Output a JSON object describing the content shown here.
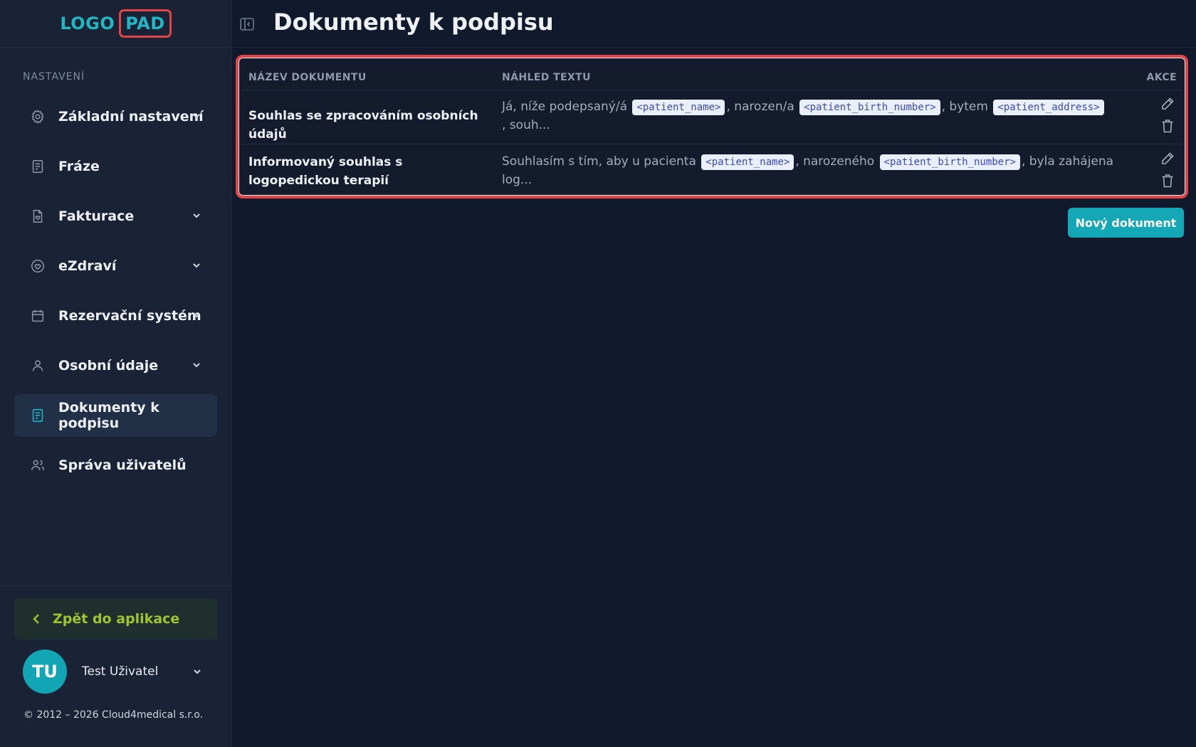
{
  "logo": {
    "left": "LOGO",
    "right": "PAD"
  },
  "sidebar": {
    "section_label": "NASTAVENÍ",
    "items": [
      {
        "label": "Základní nastavení",
        "icon": "gear-icon",
        "has_chevron": true,
        "active": false
      },
      {
        "label": "Fráze",
        "icon": "document-icon",
        "has_chevron": false,
        "active": false
      },
      {
        "label": "Fakturace",
        "icon": "invoice-icon",
        "has_chevron": true,
        "active": false
      },
      {
        "label": "eZdraví",
        "icon": "heart-shield-icon",
        "has_chevron": true,
        "active": false
      },
      {
        "label": "Rezervační systém",
        "icon": "calendar-icon",
        "has_chevron": true,
        "active": false
      },
      {
        "label": "Osobní údaje",
        "icon": "user-icon",
        "has_chevron": true,
        "active": false
      },
      {
        "label": "Dokumenty k podpisu",
        "icon": "document-icon",
        "has_chevron": false,
        "active": true
      },
      {
        "label": "Správa uživatelů",
        "icon": "users-icon",
        "has_chevron": false,
        "active": false
      }
    ],
    "back_label": "Zpět do aplikace",
    "user": {
      "initials": "TU",
      "name": "Test Uživatel"
    },
    "copyright": "© 2012 – 2026 Cloud4medical s.r.o."
  },
  "header": {
    "title": "Dokumenty k podpisu"
  },
  "table": {
    "columns": {
      "name": "NÁZEV DOKUMENTU",
      "preview": "NÁHLED TEXTU",
      "actions": "AKCE"
    },
    "rows": [
      {
        "name": "Souhlas se zpracováním osobních údajů",
        "preview": [
          {
            "text": "Já, níže podepsaný/á "
          },
          {
            "tag": "<patient_name>"
          },
          {
            "text": ", narozen/a "
          },
          {
            "tag": "<patient_birth_number>"
          },
          {
            "text": ", bytem "
          },
          {
            "tag": "<patient_address>"
          },
          {
            "text": " , souh..."
          }
        ]
      },
      {
        "name": "Informovaný souhlas s logopedickou terapií",
        "preview": [
          {
            "text": "Souhlasím s tím, aby u pacienta "
          },
          {
            "tag": "<patient_name>"
          },
          {
            "text": ", narozeného "
          },
          {
            "tag": "<patient_birth_number>"
          },
          {
            "text": ", byla zahájena log..."
          }
        ]
      }
    ]
  },
  "new_button_label": "Nový dokument",
  "colors": {
    "accent": "#14a7b6",
    "highlight": "#e24545",
    "back": "#9cc52e"
  }
}
